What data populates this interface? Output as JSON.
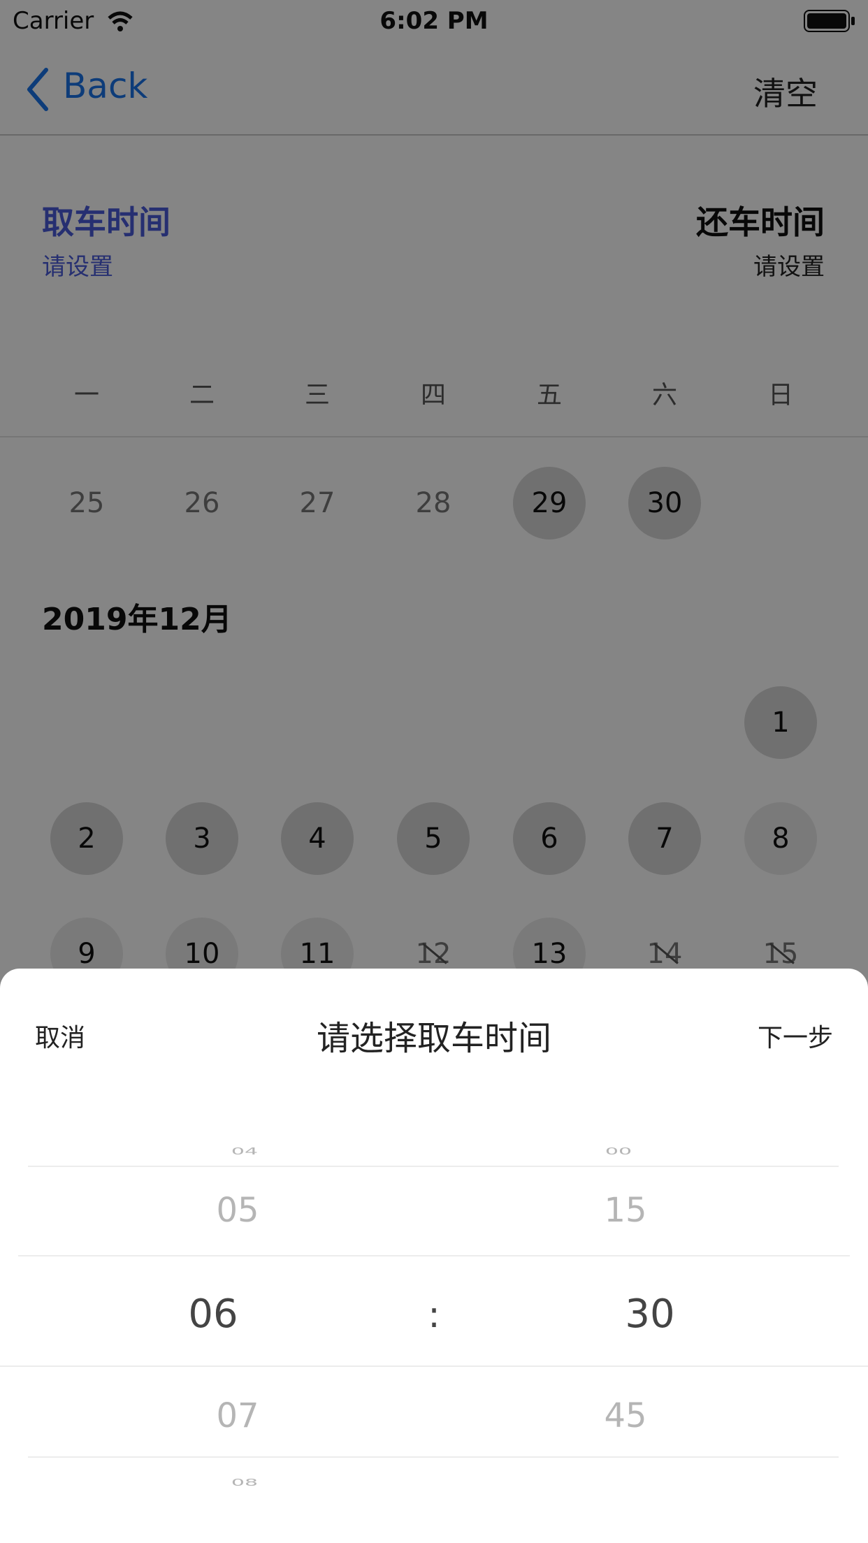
{
  "status_bar": {
    "carrier": "Carrier",
    "time": "6:02 PM"
  },
  "nav": {
    "back_label": "Back",
    "clear_label": "清空"
  },
  "header": {
    "pickup_title": "取车时间",
    "pickup_sub": "请设置",
    "return_title": "还车时间",
    "return_sub": "请设置"
  },
  "weekdays": [
    "一",
    "二",
    "三",
    "四",
    "五",
    "六",
    "日"
  ],
  "calendar": {
    "row_nov": [
      {
        "label": "25",
        "state": "plain"
      },
      {
        "label": "26",
        "state": "plain"
      },
      {
        "label": "27",
        "state": "plain"
      },
      {
        "label": "28",
        "state": "plain"
      },
      {
        "label": "29",
        "state": "available"
      },
      {
        "label": "30",
        "state": "available"
      }
    ],
    "month_title": "2019年12月",
    "row_1": [
      {
        "label": "1",
        "state": "available"
      }
    ],
    "row_2": [
      {
        "label": "2",
        "state": "available"
      },
      {
        "label": "3",
        "state": "available"
      },
      {
        "label": "4",
        "state": "available"
      },
      {
        "label": "5",
        "state": "available"
      },
      {
        "label": "6",
        "state": "available"
      },
      {
        "label": "7",
        "state": "available"
      },
      {
        "label": "8",
        "state": "partial"
      }
    ],
    "row_3": [
      {
        "label": "9",
        "state": "partial"
      },
      {
        "label": "10",
        "state": "partial"
      },
      {
        "label": "11",
        "state": "partial"
      },
      {
        "label": "12",
        "state": "unavailable"
      },
      {
        "label": "13",
        "state": "partial"
      },
      {
        "label": "14",
        "state": "unavailable"
      },
      {
        "label": "15",
        "state": "unavailable"
      }
    ]
  },
  "sheet": {
    "cancel_label": "取消",
    "title": "请选择取车时间",
    "next_label": "下一步",
    "separator": ":",
    "hours": [
      "04",
      "05",
      "06",
      "07",
      "08"
    ],
    "minutes": [
      "00",
      "15",
      "30",
      "45"
    ],
    "selected_hour": "06",
    "selected_minute": "30"
  },
  "colors": {
    "accent": "#4a5bd8",
    "link": "#1a73e8"
  }
}
